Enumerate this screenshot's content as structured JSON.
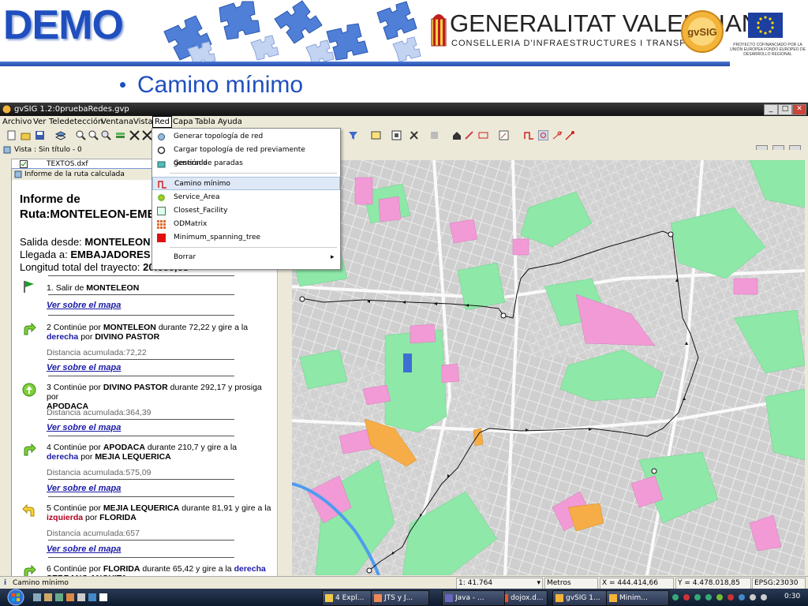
{
  "slide": {
    "demo_title": "DEMO",
    "org_title": "GENERALITAT VALENCIANA",
    "org_subtitle": "CONSELLERIA D'INFRAESTRUCTURES I TRANSPORT",
    "gvsig_logo_text": "gvSIG",
    "eu_text": "PROYECTO COFINANCIADO POR LA UNIÓN EUROPEA FONDO EUROPEO DE DESARROLLO REGIONAL",
    "subtitle": "Camino mínimo"
  },
  "window": {
    "title": "gvSIG 1.2:0pruebaRedes.gvp",
    "minimize": "_",
    "maximize": "□",
    "close": "✕"
  },
  "menubar": [
    "Archivo",
    "Ver",
    "Teledetección",
    "Ventana",
    "Vista",
    "Red",
    "Capa",
    "Tabla",
    "Ayuda"
  ],
  "vista_title": "Vista : Sin título - 0",
  "layer_name": "TEXTOS.dxf",
  "red_menu": {
    "items": [
      {
        "label": "Generar topología de red",
        "icon": "network-gear-icon"
      },
      {
        "label": "Cargar topología de red previamente generada",
        "icon": "reload-network-icon"
      },
      {
        "label": "Gestión de paradas",
        "icon": "stops-icon"
      },
      {
        "label": "Camino mínimo",
        "icon": "shortest-path-icon"
      },
      {
        "label": "Service_Area",
        "icon": "service-area-icon"
      },
      {
        "label": "Closest_Facility",
        "icon": "closest-facility-icon"
      },
      {
        "label": "ODMatrix",
        "icon": "od-matrix-icon"
      },
      {
        "label": "Minimum_spanning_tree",
        "icon": "spanning-tree-icon"
      },
      {
        "label": "Borrar",
        "icon": "",
        "submenu_arrow": "▸"
      }
    ],
    "highlighted": "Camino mínimo"
  },
  "report": {
    "window_title": "Informe de la ruta calculada",
    "heading1": "Informe de",
    "heading2": "Ruta:MONTELEON-EMBAJADORES",
    "salida_label": "Salida desde:",
    "salida_value": "MONTELEON",
    "llegada_label": "Llegada a:",
    "llegada_value": "EMBAJADORES",
    "longitud_label": "Longitud total del trayecto:",
    "longitud_value": "20.660,63",
    "link_text": "Ver sobre el mapa",
    "steps": [
      {
        "num": "1.",
        "text": "Salir de",
        "street": "MONTELEON"
      },
      {
        "num": "2",
        "pre": "Continúe por",
        "street": "MONTELEON",
        "mid": "durante 72,22 y gire a la",
        "dir": "derecha",
        "por": "por",
        "next": "DIVINO PASTOR",
        "dist": "Distancia acumulada:72,22"
      },
      {
        "num": "3",
        "pre": "Continúe por",
        "street": "DIVINO PASTOR",
        "mid": "durante 292,17 y prosiga por",
        "next": "APODACA",
        "dist": "Distancia acumulada:364,39"
      },
      {
        "num": "4",
        "pre": "Continúe por",
        "street": "APODACA",
        "mid": "durante 210,7 y gire a la",
        "dir": "derecha",
        "por": "por",
        "next": "MEJIA LEQUERICA",
        "dist": "Distancia acumulada:575,09"
      },
      {
        "num": "5",
        "pre": "Continúe por",
        "street": "MEJIA LEQUERICA",
        "mid": "durante 81,91 y gire a la",
        "dir": "izquierda",
        "por": "por",
        "next": "FLORIDA",
        "dist": "Distancia acumulada:657"
      },
      {
        "num": "6",
        "pre": "Continúe por",
        "street": "FLORIDA",
        "mid": "durante 65,42 y gire a la",
        "dir": "derecha",
        "next": "SERRANO ANGUITA"
      }
    ]
  },
  "statusbar": {
    "message": "Camino mínimo",
    "scale": "1: 41.764",
    "units": "Metros",
    "x": "X = 444.414,66",
    "y": "Y = 4.478.018,85",
    "epsg": "EPSG:23030"
  },
  "taskbar": {
    "tasks": [
      "4 Expl...",
      "JTS y J...",
      "dojox.d...",
      "Java - ...",
      "gvSIG 1...",
      "Minim..."
    ],
    "clock": "0:30"
  },
  "colors": {
    "accent_blue": "#1f4fbf",
    "park_green": "#8ee8a8",
    "area_pink": "#f29ad6",
    "area_orange": "#f6ad47",
    "street_gray": "#cfcfcf"
  }
}
